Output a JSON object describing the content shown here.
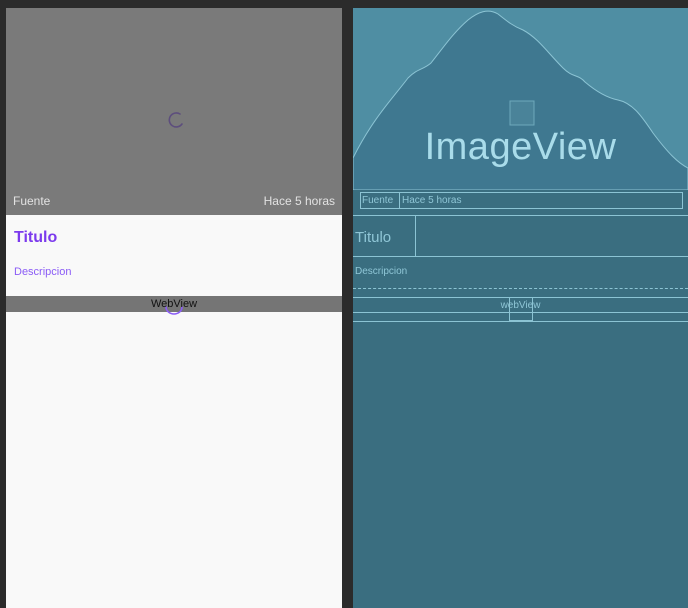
{
  "design": {
    "source": "Fuente",
    "time": "Hace 5 horas",
    "title": "Titulo",
    "description": "Descripcion",
    "webview_label": "WebView",
    "accent": "#7c3aed"
  },
  "blueprint": {
    "image_label": "ImageView",
    "source": "Fuente",
    "time": "Hace 5 horas",
    "title": "Titulo",
    "description": "Descripcion",
    "webview_label": "webView",
    "background": "#3a6e80"
  }
}
